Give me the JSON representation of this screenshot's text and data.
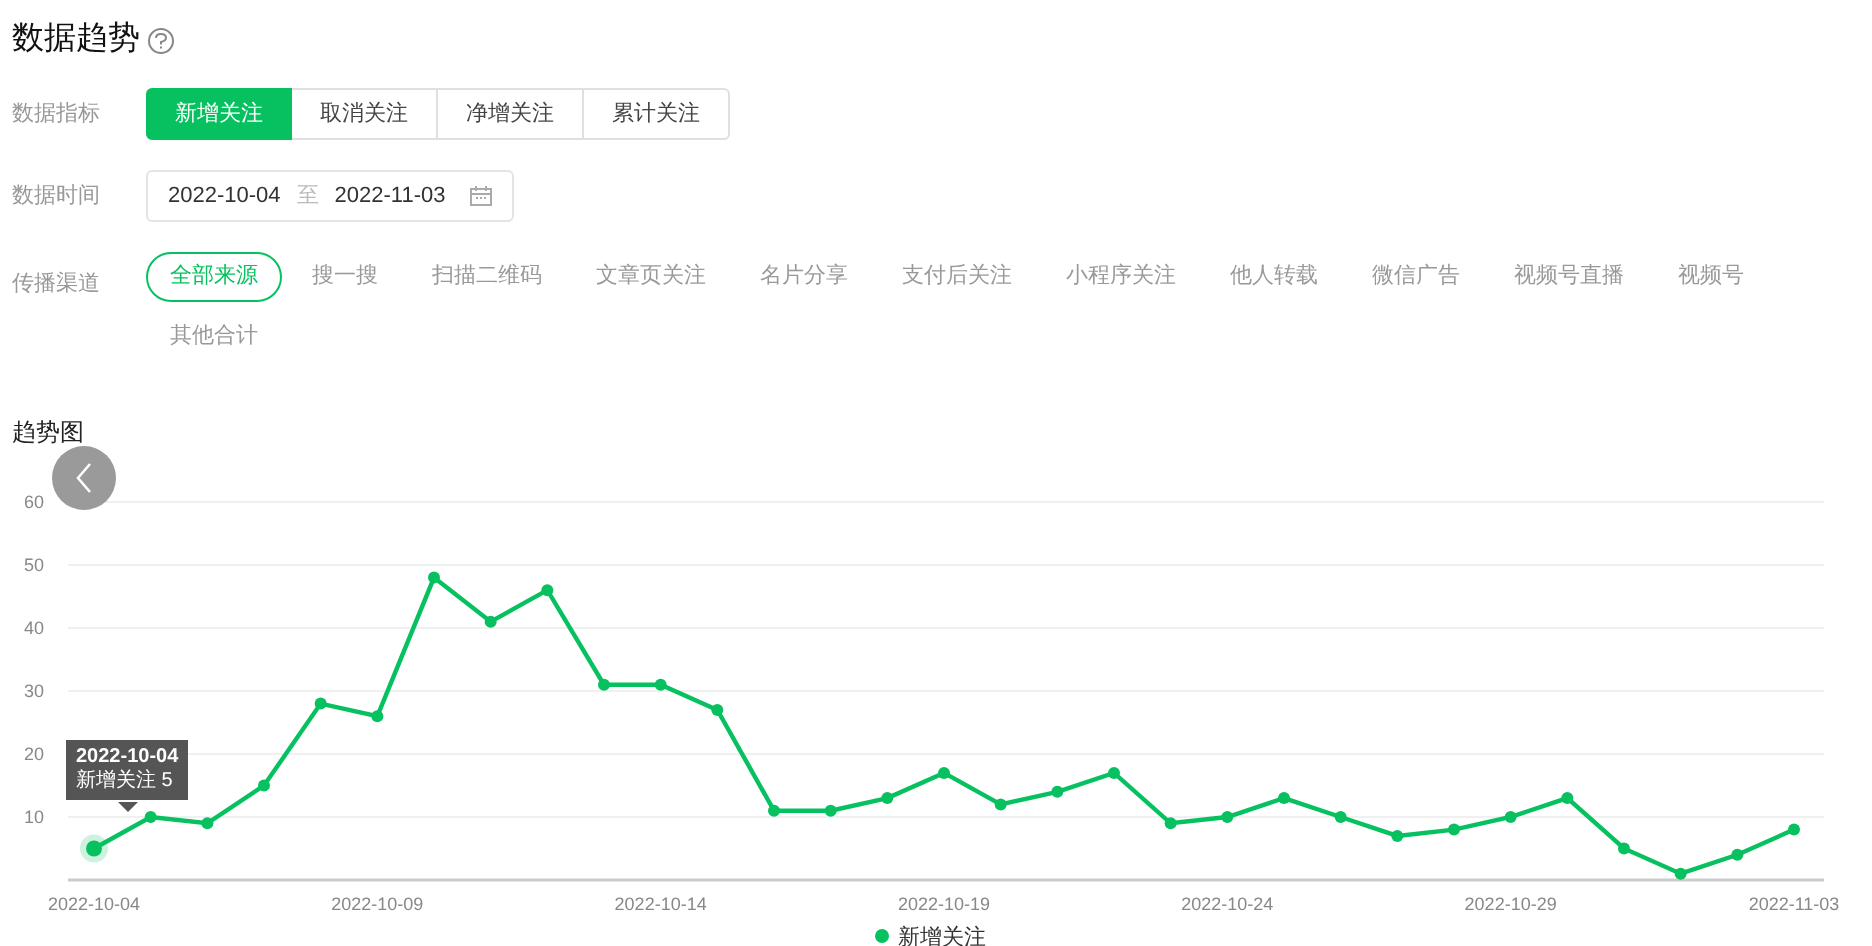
{
  "title": "数据趋势",
  "metric_row": {
    "label": "数据指标",
    "options": [
      {
        "label": "新增关注",
        "selected": true
      },
      {
        "label": "取消关注",
        "selected": false
      },
      {
        "label": "净增关注",
        "selected": false
      },
      {
        "label": "累计关注",
        "selected": false
      }
    ]
  },
  "date_row": {
    "label": "数据时间",
    "start": "2022-10-04",
    "separator": "至",
    "end": "2022-11-03"
  },
  "channel_row": {
    "label": "传播渠道",
    "options": [
      {
        "label": "全部来源",
        "selected": true
      },
      {
        "label": "搜一搜",
        "selected": false
      },
      {
        "label": "扫描二维码",
        "selected": false
      },
      {
        "label": "文章页关注",
        "selected": false
      },
      {
        "label": "名片分享",
        "selected": false
      },
      {
        "label": "支付后关注",
        "selected": false
      },
      {
        "label": "小程序关注",
        "selected": false
      },
      {
        "label": "他人转载",
        "selected": false
      },
      {
        "label": "微信广告",
        "selected": false
      },
      {
        "label": "视频号直播",
        "selected": false
      },
      {
        "label": "视频号",
        "selected": false
      },
      {
        "label": "其他合计",
        "selected": false
      }
    ]
  },
  "trend": {
    "title": "趋势图",
    "tooltip": {
      "date": "2022-10-04",
      "text": "新增关注 5"
    },
    "chart_data": {
      "type": "line",
      "categories": [
        "2022-10-04",
        null,
        null,
        null,
        null,
        "2022-10-09",
        null,
        null,
        null,
        null,
        "2022-10-14",
        null,
        null,
        null,
        null,
        "2022-10-19",
        null,
        null,
        null,
        null,
        "2022-10-24",
        null,
        null,
        null,
        null,
        "2022-10-29",
        null,
        null,
        null,
        null,
        "2022-11-03"
      ],
      "series": [
        {
          "name": "新增关注",
          "color": "#07c160",
          "marker": "circle",
          "values": [
            5,
            10,
            9,
            15,
            28,
            26,
            48,
            41,
            46,
            31,
            31,
            27,
            11,
            11,
            13,
            17,
            12,
            14,
            17,
            9,
            10,
            13,
            10,
            7,
            8,
            10,
            13,
            5,
            1,
            4,
            8
          ]
        }
      ],
      "grid": true,
      "ylim": [
        0,
        60
      ],
      "yticks": [
        10,
        20,
        30,
        40,
        50,
        60
      ]
    }
  }
}
